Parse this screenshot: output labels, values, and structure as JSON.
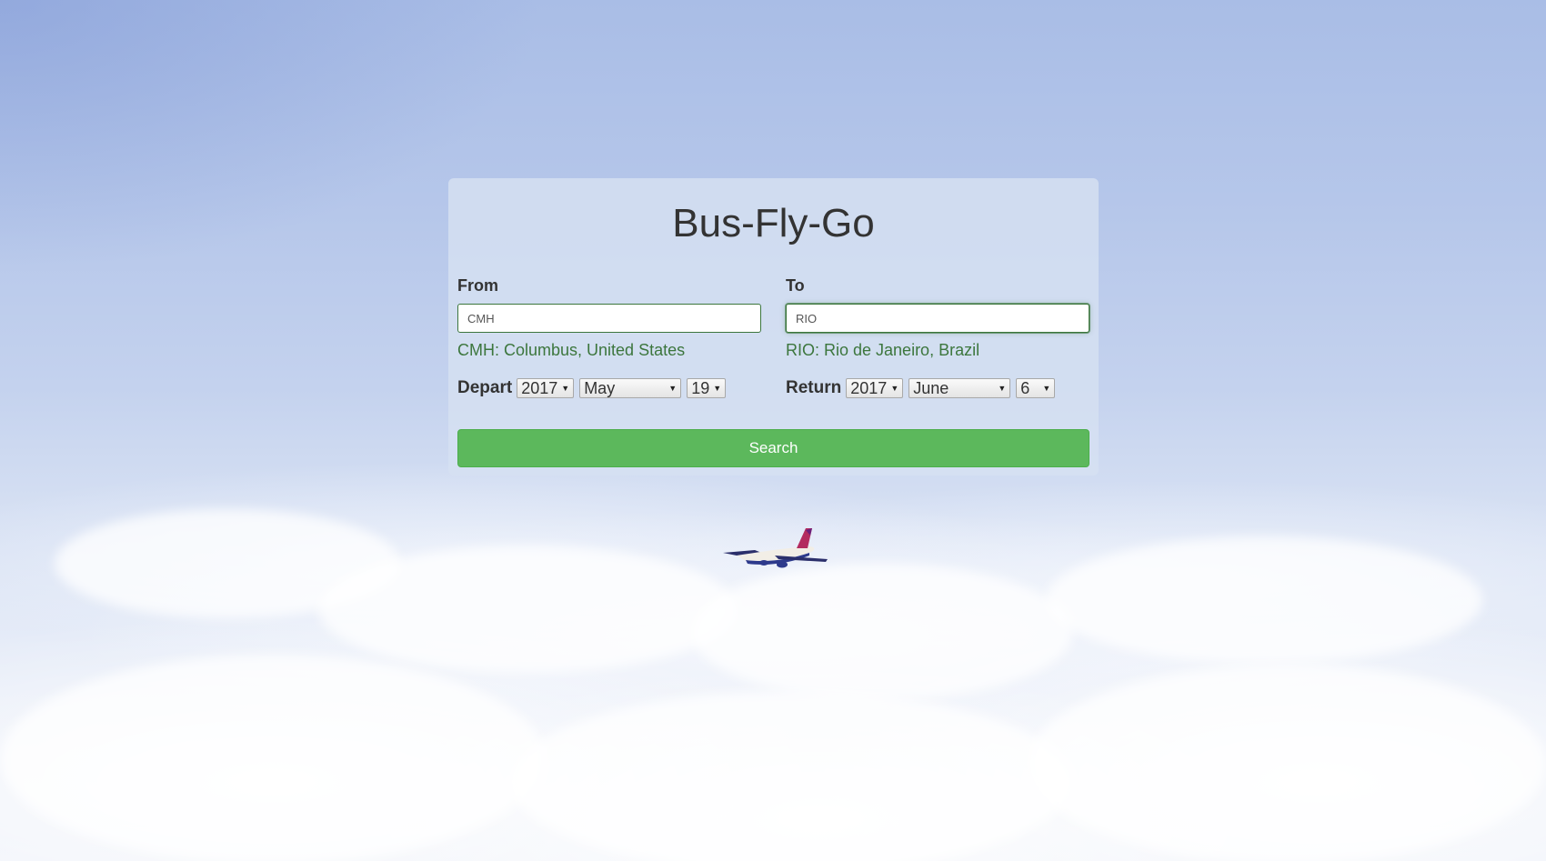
{
  "app": {
    "title": "Bus-Fly-Go"
  },
  "from": {
    "label": "From",
    "value": "CMH",
    "match": "CMH: Columbus, United States"
  },
  "to": {
    "label": "To",
    "value": "RIO",
    "match": "RIO: Rio de Janeiro, Brazil"
  },
  "depart": {
    "label": "Depart",
    "year": "2017",
    "month": "May",
    "day": "19"
  },
  "return": {
    "label": "Return",
    "year": "2017",
    "month": "June",
    "day": "6"
  },
  "actions": {
    "search_label": "Search"
  },
  "colors": {
    "success_green": "#3c763d",
    "button_green": "#5cb85c"
  },
  "icons": {
    "dropdown": "chevron-down-icon",
    "background": "airplane-over-clouds"
  }
}
